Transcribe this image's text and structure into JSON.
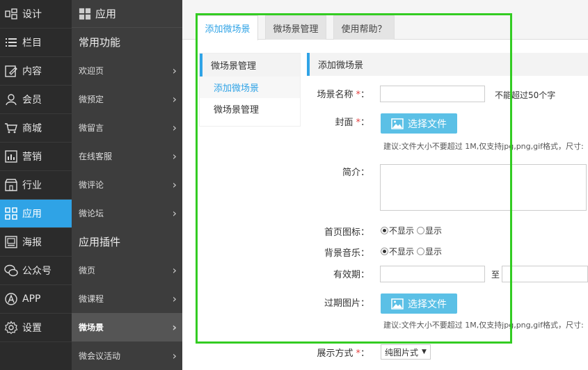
{
  "nav_primary": [
    {
      "label": "设计",
      "icon": "design-icon"
    },
    {
      "label": "栏目",
      "icon": "list-icon"
    },
    {
      "label": "内容",
      "icon": "edit-icon"
    },
    {
      "label": "会员",
      "icon": "user-icon"
    },
    {
      "label": "商城",
      "icon": "cart-icon"
    },
    {
      "label": "营销",
      "icon": "chart-icon"
    },
    {
      "label": "行业",
      "icon": "store-icon"
    },
    {
      "label": "应用",
      "icon": "apps-icon",
      "active": true
    },
    {
      "label": "海报",
      "icon": "poster-icon"
    },
    {
      "label": "公众号",
      "icon": "wechat-icon"
    },
    {
      "label": "APP",
      "icon": "app-icon"
    },
    {
      "label": "设置",
      "icon": "gear-icon"
    }
  ],
  "nav_secondary": {
    "header": "应用",
    "section1": "常用功能",
    "group1": [
      "欢迎页",
      "微预定",
      "微留言",
      "在线客服",
      "微评论",
      "微论坛"
    ],
    "section2": "应用插件",
    "group2": [
      "微页",
      "微课程",
      "微场景",
      "微会议活动"
    ]
  },
  "tabs": [
    "添加微场景",
    "微场景管理",
    "使用帮助？"
  ],
  "side_menu": {
    "title": "微场景管理",
    "items": [
      "添加微场景",
      "微场景管理"
    ]
  },
  "form": {
    "header": "添加微场景",
    "name_label": "场景名称",
    "name_hint": "不能超过50个字",
    "cover_label": "封面",
    "choose_file": "选择文件",
    "file_hint": "建议:文件大小不要超过 1M,仅支持jpg,png,gif格式，尺寸:",
    "intro_label": "简介：",
    "home_icon_label": "首页图标：",
    "bg_music_label": "背景音乐：",
    "opt_hide": "不显示",
    "opt_show": "显示",
    "validity_label": "有效期：",
    "to_text": "至",
    "expired_img_label": "过期图片：",
    "display_label": "展示方式",
    "display_value": "纯图片式"
  },
  "colors": {
    "accent": "#2fa3e6",
    "highlight_box": "#33cc22",
    "button": "#5bc0e6"
  }
}
